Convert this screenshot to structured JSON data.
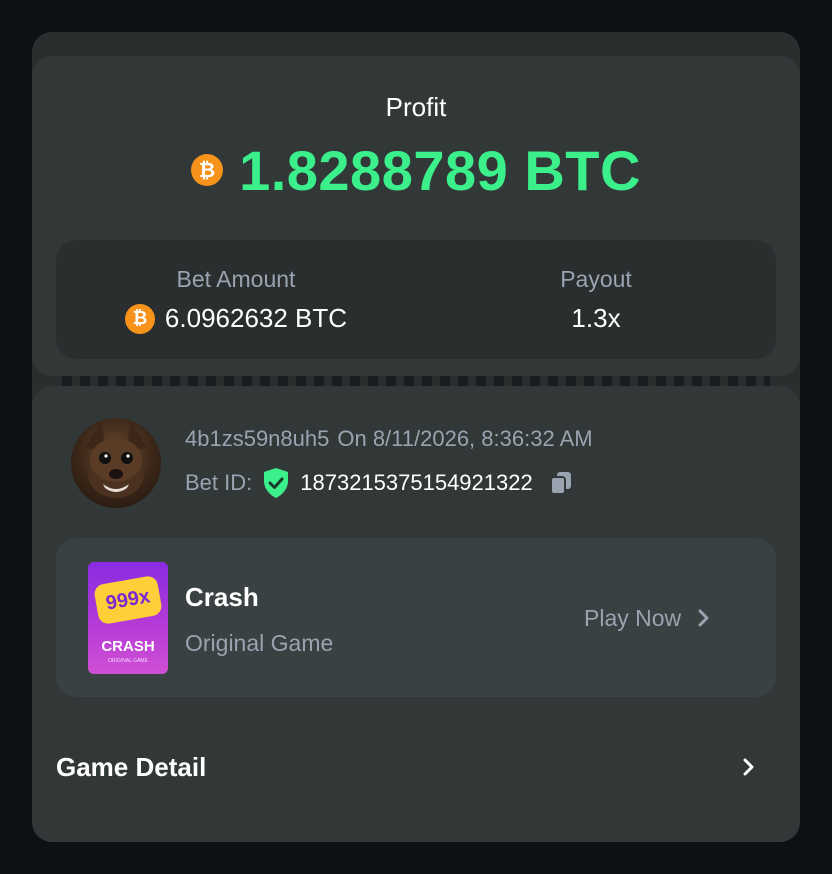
{
  "profit": {
    "label": "Profit",
    "amount": "1.8288789 BTC",
    "currency_icon": "bitcoin-icon",
    "color": "#3bf08a"
  },
  "stats": {
    "bet_amount_label": "Bet Amount",
    "bet_amount_value": "6.0962632 BTC",
    "payout_label": "Payout",
    "payout_value": "1.3x"
  },
  "bet": {
    "user": "4b1zs59n8uh5",
    "timestamp": "On 8/11/2026, 8:36:32 AM",
    "bet_id_label": "Bet ID:",
    "bet_id": "1873215375154921322",
    "verified_icon": "shield-check-icon",
    "copy_icon": "copy-icon"
  },
  "game": {
    "name": "Crash",
    "type": "Original Game",
    "play_label": "Play Now",
    "thumbnail_badge": "999x",
    "thumbnail_title": "CRASH",
    "thumbnail_subtitle": "ORIGINAL GAME"
  },
  "detail": {
    "label": "Game Detail"
  },
  "colors": {
    "background": "#0d1014",
    "panel": "#323738",
    "accent_green": "#3bf08a",
    "bitcoin_orange": "#f7931a",
    "muted_text": "#99a4b0"
  }
}
